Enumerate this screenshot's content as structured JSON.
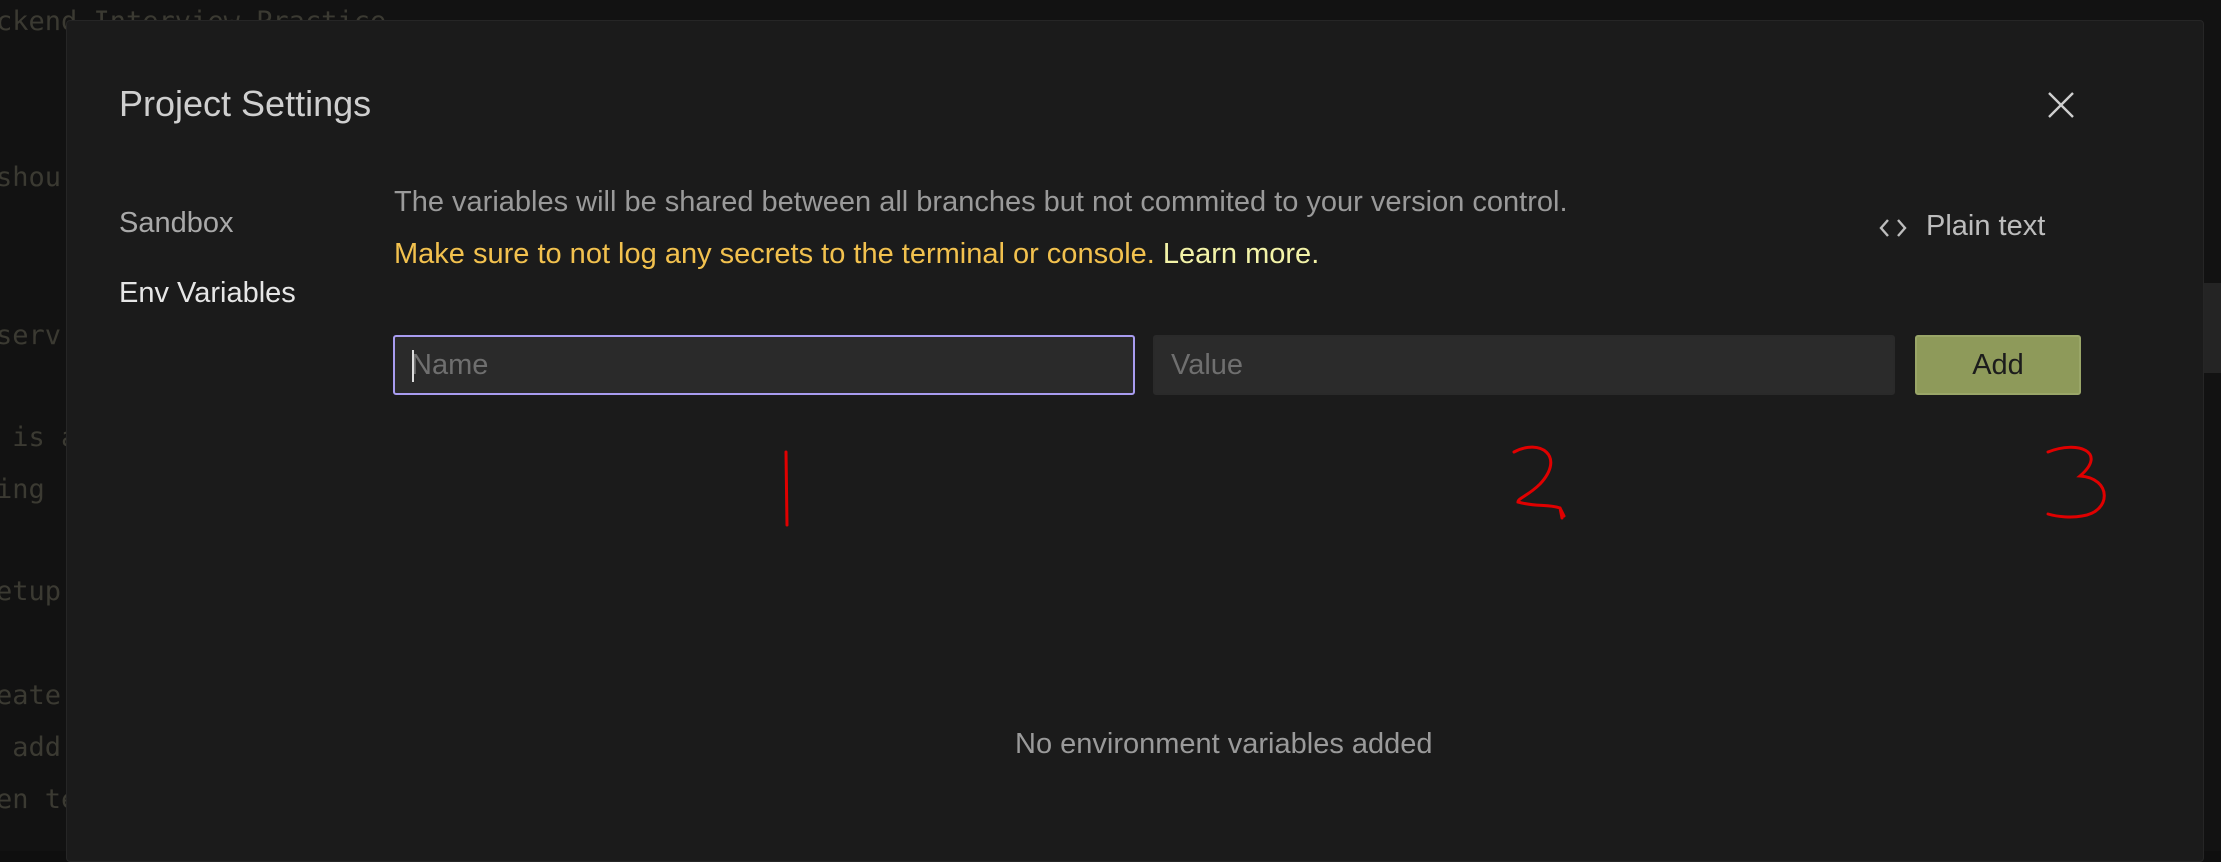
{
  "background": {
    "code_lines": [
      "ckend Interview Practice",
      "shou",
      "serv",
      " is a",
      "ing",
      "etup",
      "eate",
      " add",
      "en te"
    ]
  },
  "modal": {
    "title": "Project Settings",
    "close_icon": "close-icon"
  },
  "sidebar": {
    "items": [
      {
        "label": "Sandbox",
        "active": false
      },
      {
        "label": "Env Variables",
        "active": true
      }
    ]
  },
  "env": {
    "description": "The variables will be shared between all branches but not commited to your version control.",
    "warning": "Make sure to not log any secrets to the terminal or console.",
    "learn_more": "Learn more.",
    "plain_text_label": "Plain text",
    "plain_text_icon": "code-brackets-icon",
    "name_placeholder": "Name",
    "value_placeholder": "Value",
    "add_label": "Add",
    "empty_text": "No environment variables added"
  },
  "annotations": {
    "labels": [
      "1",
      "2",
      "3"
    ],
    "color": "#e00000"
  },
  "colors": {
    "accent_border": "#a89cf0",
    "add_button": "#8e9a5a",
    "warning": "#f2c14e",
    "link": "#f3f3a8"
  }
}
